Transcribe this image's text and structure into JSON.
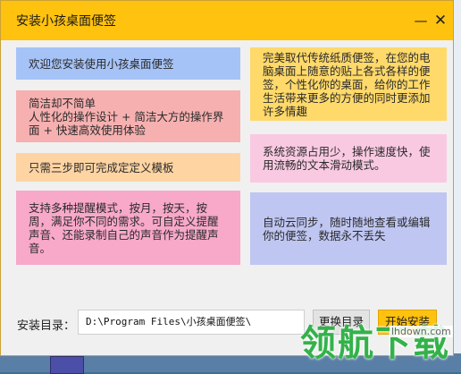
{
  "window": {
    "title": "安装小孩桌面便签",
    "minimize_symbol": "—",
    "close_symbol": "✕"
  },
  "features": [
    {
      "text": "欢迎您安装使用小孩桌面便签",
      "color": "#a6c3f7"
    },
    {
      "text": "简洁却不简单\n人性化的操作设计 + 简洁大方的操作界面 + 快速高效使用体验",
      "color": "#f7b0b0"
    },
    {
      "text": "只需三步即可完成定定义模板",
      "color": "#fed4a3"
    },
    {
      "text": "支持多种提醒模式，按月，按天，按周，满足你不同的需求。可自定义提醒声音、还能录制自己的声音作为提醒声音。",
      "color": "#f8a8c9"
    },
    {
      "text": "完美取代传统纸质便签，在您的电脑桌面上随意的贴上各式各样的便签，个性化你的桌面，给你的工作生活带来更多的方便的同时更添加许多情趣",
      "color": "#ffd96a"
    },
    {
      "text": "系统资源占用少，操作速度快，使用流畅的文本滑动模式。",
      "color": "#f9c9e2"
    },
    {
      "text": "自动云同步，随时随地查看或编辑你的便签，数据永不丢失",
      "color": "#bfc6f2"
    }
  ],
  "install": {
    "dir_label": "安装目录：",
    "dir_value": "D:\\Program Files\\小孩桌面便签\\",
    "change_label": "更换目录",
    "install_label": "开始安装"
  },
  "watermark": {
    "text": "领航下载",
    "url": "lhdown.com"
  }
}
